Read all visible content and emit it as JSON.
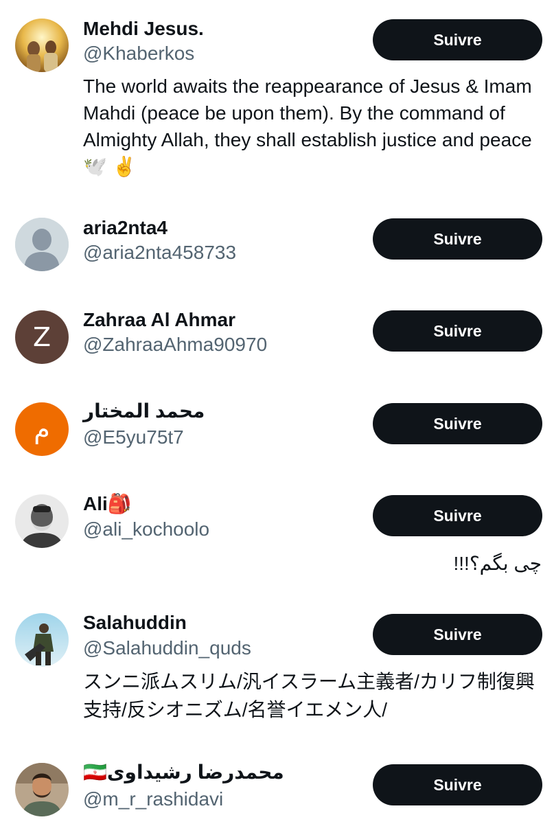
{
  "users": [
    {
      "name": "Mehdi Jesus.",
      "handle": "@Khaberkos",
      "bio": "The world awaits the reappearance of Jesus & Imam Mahdi (peace be upon them). By the command of Almighty Allah, they shall establish justice and peace 🕊️ ✌️",
      "follow_label": "Suivre",
      "avatar_icon": "portrait-photo"
    },
    {
      "name": "aria2nta4",
      "handle": "@aria2nta458733",
      "follow_label": "Suivre",
      "avatar_icon": "default-avatar-icon"
    },
    {
      "name": "Zahraa Al Ahmar",
      "handle": "@ZahraaAhma90970",
      "follow_label": "Suivre",
      "avatar_letter": "Z",
      "avatar_color": "#5d4037"
    },
    {
      "name": "محمد المختار",
      "handle": "@E5yu75t7",
      "follow_label": "Suivre",
      "avatar_letter": "م",
      "avatar_color": "#ef6c00"
    },
    {
      "name": "Ali🎒",
      "handle": "@ali_kochoolo",
      "bio": "چی بگم؟!!!",
      "follow_label": "Suivre",
      "avatar_icon": "portrait-photo"
    },
    {
      "name": "Salahuddin",
      "handle": "@Salahuddin_quds",
      "bio": "スンニ派ムスリム/汎イスラーム主義者/カリフ制復興支持/反シオニズム/名誉イエメン人/",
      "follow_label": "Suivre",
      "avatar_icon": "portrait-photo"
    },
    {
      "name": "🇮🇷محمدرضا رشیداوی",
      "handle": "@m_r_rashidavi",
      "follow_label": "Suivre",
      "avatar_icon": "portrait-photo"
    }
  ],
  "colors": {
    "primary_text": "#0f1419",
    "secondary_text": "#536471",
    "button_bg": "#0f1419",
    "button_text": "#ffffff"
  }
}
